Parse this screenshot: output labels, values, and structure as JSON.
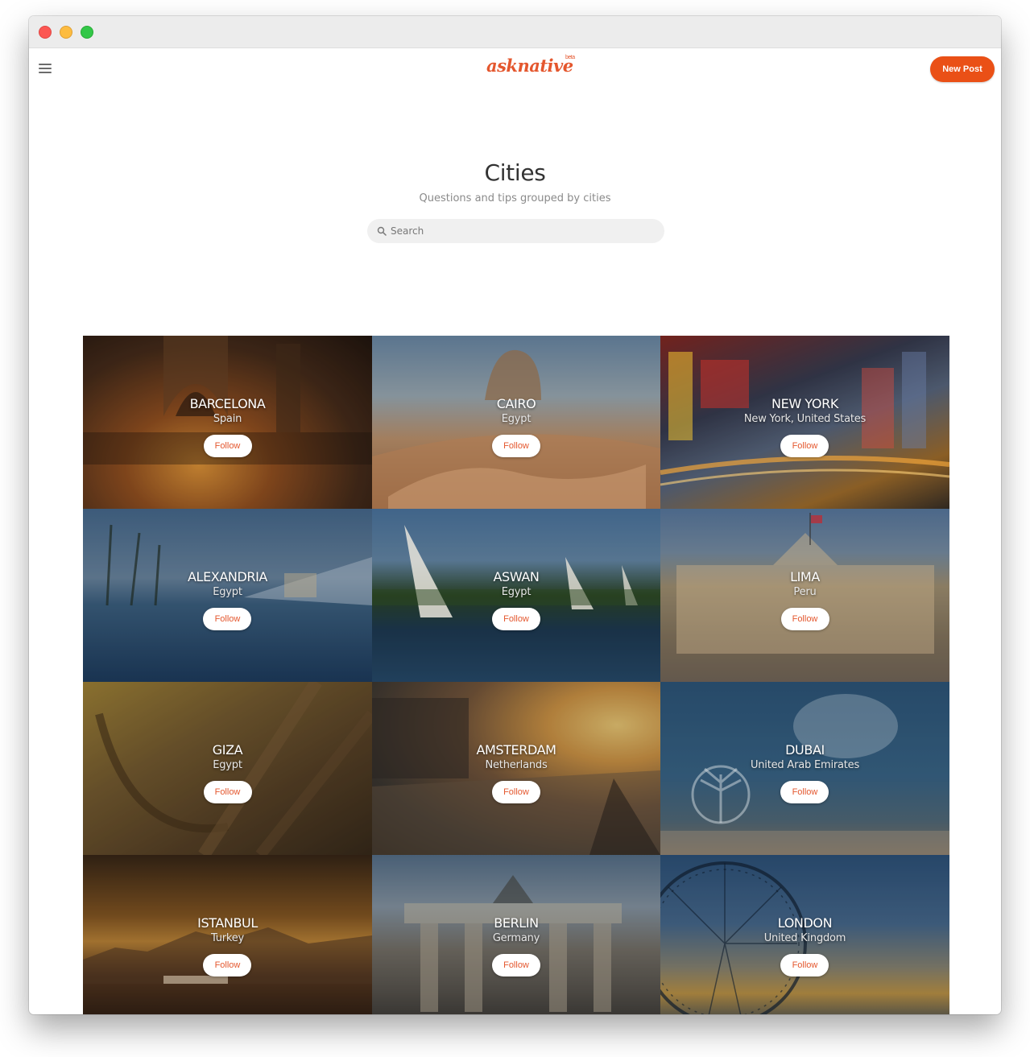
{
  "app": {
    "logo_text": "asknative",
    "logo_badge": "beta",
    "new_post_label": "New Post",
    "accent": "#ea5016"
  },
  "header": {
    "title": "Cities",
    "subtitle": "Questions and tips grouped by cities"
  },
  "search": {
    "placeholder": "Search",
    "value": ""
  },
  "cities": [
    {
      "name": "BARCELONA",
      "country": "Spain",
      "follow_label": "Follow"
    },
    {
      "name": "CAIRO",
      "country": "Egypt",
      "follow_label": "Follow"
    },
    {
      "name": "NEW YORK",
      "country": "New York, United States",
      "follow_label": "Follow"
    },
    {
      "name": "ALEXANDRIA",
      "country": "Egypt",
      "follow_label": "Follow"
    },
    {
      "name": "ASWAN",
      "country": "Egypt",
      "follow_label": "Follow"
    },
    {
      "name": "LIMA",
      "country": "Peru",
      "follow_label": "Follow"
    },
    {
      "name": "GIZA",
      "country": "Egypt",
      "follow_label": "Follow"
    },
    {
      "name": "AMSTERDAM",
      "country": "Netherlands",
      "follow_label": "Follow"
    },
    {
      "name": "DUBAI",
      "country": "United Arab Emirates",
      "follow_label": "Follow"
    },
    {
      "name": "ISTANBUL",
      "country": "Turkey",
      "follow_label": "Follow"
    },
    {
      "name": "BERLIN",
      "country": "Germany",
      "follow_label": "Follow"
    },
    {
      "name": "LONDON",
      "country": "United Kingdom",
      "follow_label": "Follow"
    }
  ]
}
